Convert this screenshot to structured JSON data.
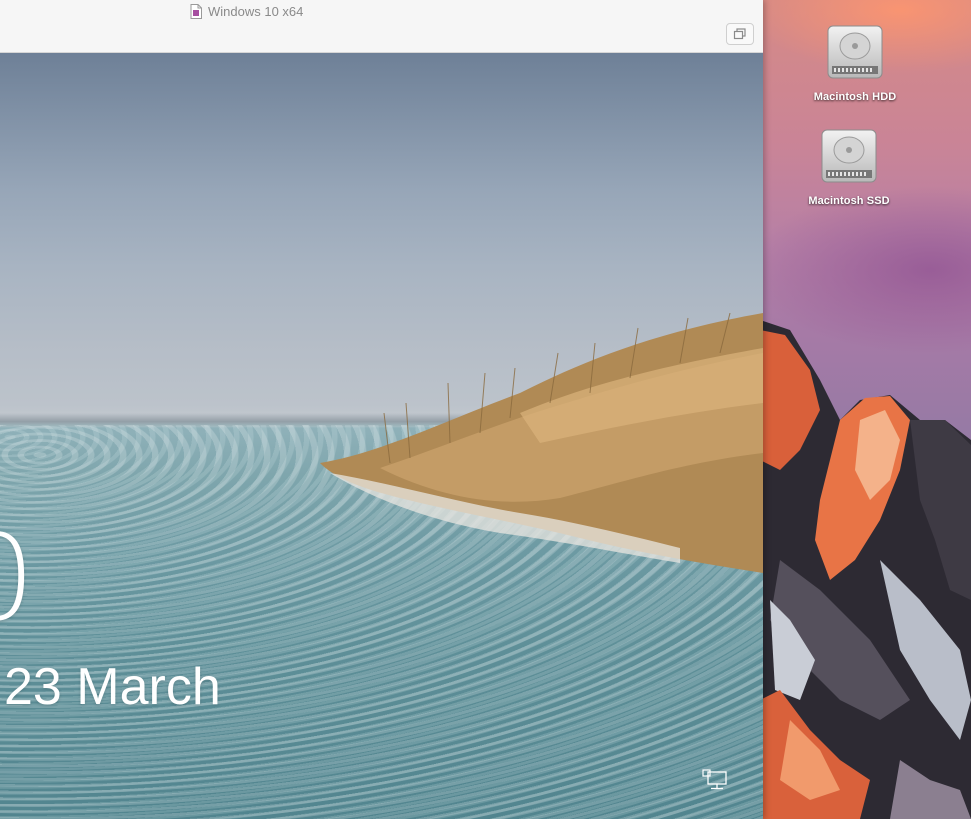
{
  "vm_window": {
    "title": "Windows 10 x64",
    "title_icon": "document-icon",
    "fullscreen_icon": "restore-window-icon"
  },
  "lock_screen": {
    "time_partial": "0",
    "date_partial": "23 March",
    "network_icon": "network-icon"
  },
  "desktop": {
    "icons": [
      {
        "label": "Macintosh HDD",
        "icon": "hard-drive-icon"
      },
      {
        "label": "Macintosh SSD",
        "icon": "hard-drive-icon"
      }
    ]
  },
  "colors": {
    "titlebar": "#f6f6f6",
    "title_text": "#8a8a8a",
    "lock_text": "#ffffff",
    "mac_sky": "#a77aa6"
  }
}
